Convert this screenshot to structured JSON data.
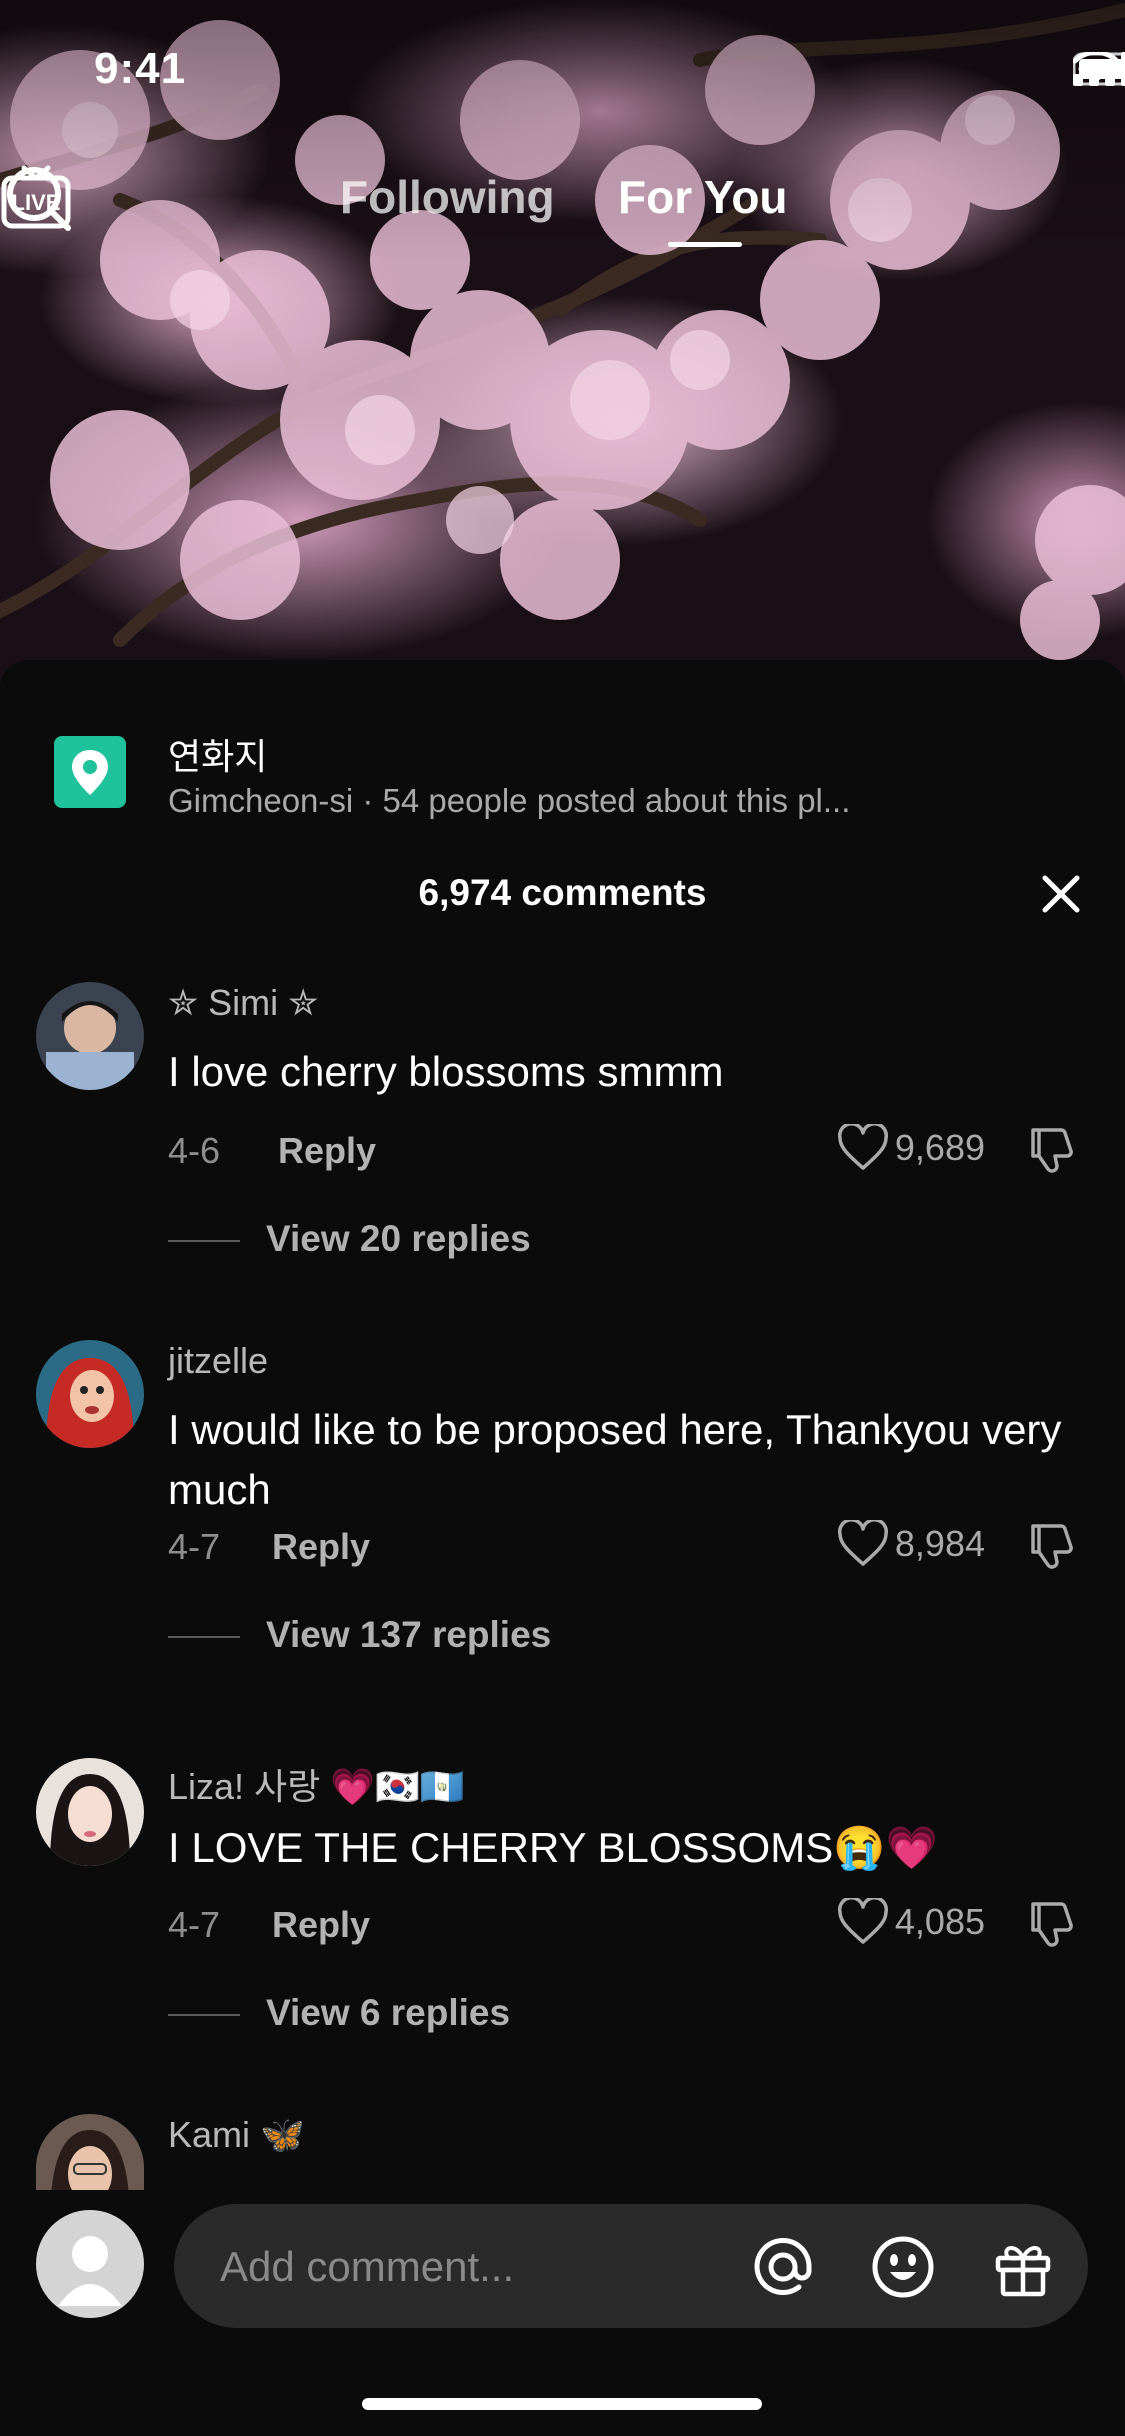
{
  "status_bar": {
    "time": "9:41"
  },
  "top_nav": {
    "live_label": "LIVE",
    "tabs": [
      {
        "label": "Following",
        "active": false
      },
      {
        "label": "For You",
        "active": true
      }
    ]
  },
  "place": {
    "title": "연화지",
    "subtitle": "Gimcheon-si · 54 people posted about this pl..."
  },
  "comments_header": {
    "count_label": "6,974 comments"
  },
  "comments": [
    {
      "user": "✮ Simi ✮",
      "text": "I love cherry blossoms smmm",
      "date": "4-6",
      "reply_label": "Reply",
      "likes": "9,689",
      "view_replies": "View 20 replies"
    },
    {
      "user": "jitzelle",
      "text": "I would like to be proposed here, Thankyou very much",
      "date": "4-7",
      "reply_label": "Reply",
      "likes": "8,984",
      "view_replies": "View 137 replies"
    },
    {
      "user": "Liza! 사랑 💗🇰🇷🇬🇹",
      "text": "I LOVE THE CHERRY BLOSSOMS😭💗",
      "date": "4-7",
      "reply_label": "Reply",
      "likes": "4,085",
      "view_replies": "View 6 replies"
    },
    {
      "user": "Kami 🦋"
    }
  ],
  "comment_input": {
    "placeholder": "Add comment..."
  },
  "colors": {
    "place_pin": "#20c29b",
    "sheet_bg": "#0b0b0b",
    "input_bg": "#2a2a2a"
  }
}
